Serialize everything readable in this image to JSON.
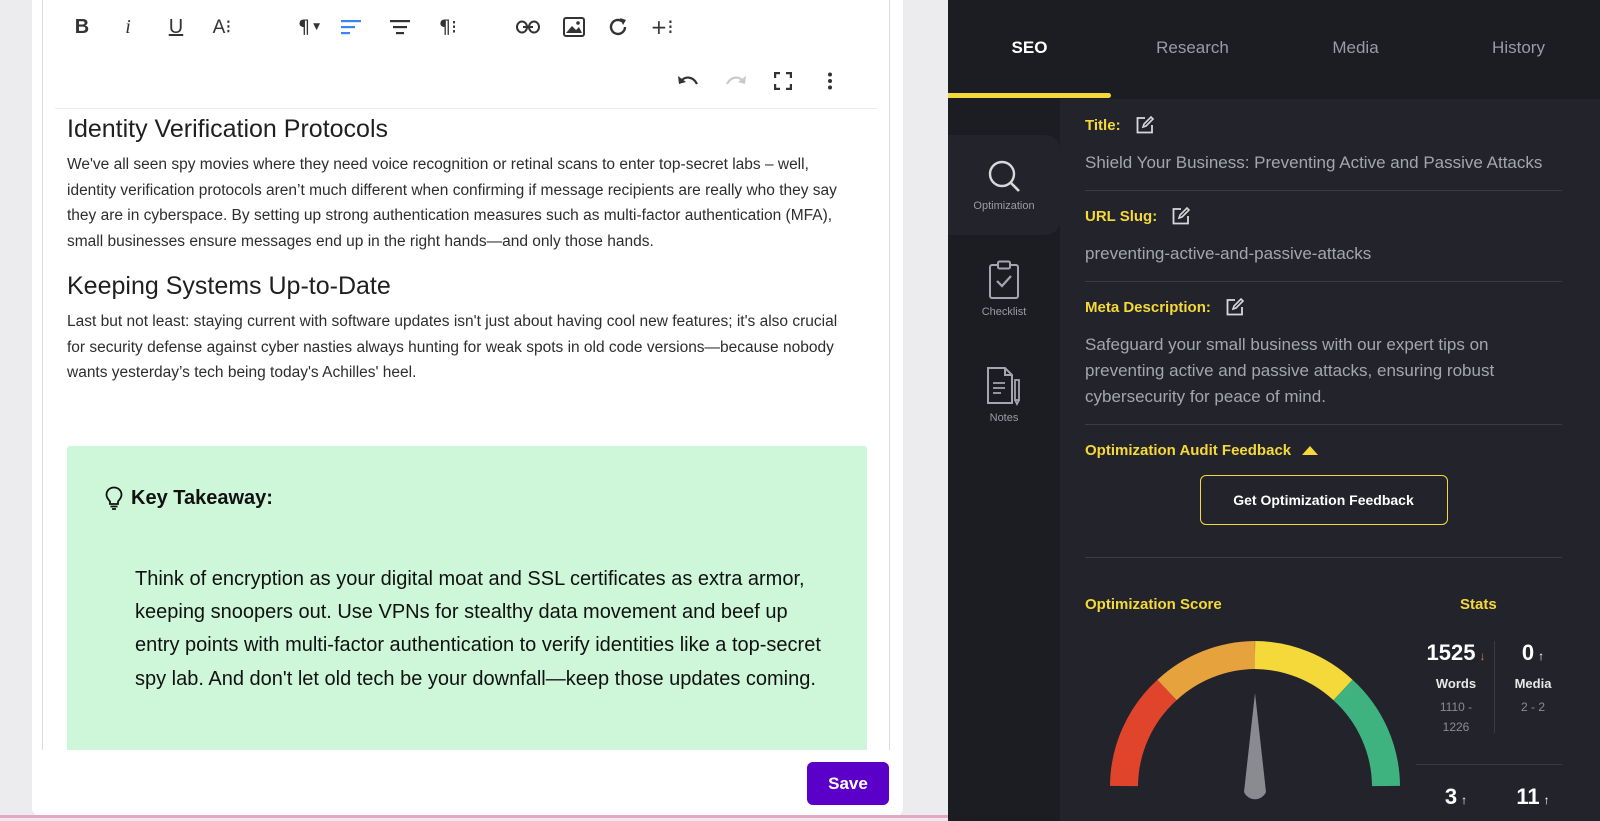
{
  "toolbar": {
    "row1": [
      {
        "name": "bold-button",
        "glyph": "B"
      },
      {
        "name": "italic-button",
        "glyph": "i"
      },
      {
        "name": "underline-button",
        "glyph": "U"
      },
      {
        "name": "font-size-button",
        "glyph": "A⁝"
      },
      {
        "name": "paragraph-format-button",
        "glyph": "¶▾"
      },
      {
        "name": "align-left-button",
        "glyph": "align-left-icon"
      },
      {
        "name": "align-center-button",
        "glyph": "align-center-icon"
      },
      {
        "name": "paragraph-more-button",
        "glyph": "¶⁝"
      },
      {
        "name": "insert-link-button",
        "glyph": "link-icon"
      },
      {
        "name": "insert-image-button",
        "glyph": "image-icon"
      },
      {
        "name": "redo-rotate-button",
        "glyph": "rotate-icon"
      },
      {
        "name": "insert-more-button",
        "glyph": "+⁝"
      }
    ],
    "row2": [
      "undo-icon",
      "redo-icon",
      "fullscreen-icon",
      "more-vertical-icon"
    ]
  },
  "article": {
    "heading1": "Identity Verification Protocols",
    "para1": "We've all seen spy movies where they need voice recognition or retinal scans to enter top-secret labs – well, identity verification protocols aren’t much different when confirming if message recipients are really who they say they are in cyberspace. By setting up strong authentication measures such as multi-factor authentication (MFA), small businesses ensure messages end up in the right hands—and only those hands.",
    "heading2": "Keeping Systems Up-to-Date",
    "para2": "Last but not least: staying current with software updates isn't just about having cool new features; it's also crucial for security defense against cyber nasties always hunting for weak spots in old code versions—because nobody wants yesterday’s tech being today's Achilles' heel.",
    "takeaway_title": "Key Takeaway:",
    "takeaway_text": "Think of encryption as your digital moat and SSL certificates as extra armor, keeping snoopers out. Use VPNs for stealthy data movement and beef up entry points with multi-factor authentication to verify identities like a top-secret spy lab. And don't let old tech be your downfall—keep those updates coming."
  },
  "save_label": "Save",
  "tabs": [
    {
      "label": "SEO",
      "active": true
    },
    {
      "label": "Research",
      "active": false
    },
    {
      "label": "Media",
      "active": false
    },
    {
      "label": "History",
      "active": false
    }
  ],
  "side_nav": {
    "optimization": "Optimization",
    "checklist": "Checklist",
    "notes": "Notes"
  },
  "seo": {
    "title_label": "Title:",
    "title_value": "Shield Your Business: Preventing Active and Passive Attacks",
    "slug_label": "URL Slug:",
    "slug_value": "preventing-active-and-passive-attacks",
    "meta_label": "Meta Description:",
    "meta_value": "Safeguard your small business with our expert tips on preventing active and passive attacks, ensuring robust cybersecurity for peace of mind.",
    "audit_label": "Optimization Audit Feedback",
    "feedback_button": "Get Optimization Feedback",
    "score_title": "Optimization Score",
    "stats_title": "Stats"
  },
  "stats": {
    "words": {
      "value": "1525",
      "arrow": "↓",
      "label": "Words",
      "range_line1": "1110 -",
      "range_line2": "1226"
    },
    "media": {
      "value": "0",
      "arrow": "↑",
      "label": "Media",
      "range_line1": "2 - 2"
    },
    "stat3": {
      "value": "3",
      "arrow": "↑"
    },
    "stat4": {
      "value": "11",
      "arrow": "↑"
    }
  },
  "colors": {
    "accent": "#f5d93a",
    "save_button": "#5a00c8",
    "takeaway_bg": "#cdf7d8",
    "gauge_red": "#e0452b",
    "gauge_orange": "#e6a23c",
    "gauge_yellow": "#f5d93a",
    "gauge_green": "#3fb37f",
    "arrow_down": "#e07b39",
    "arrow_up": "#ffffff"
  }
}
